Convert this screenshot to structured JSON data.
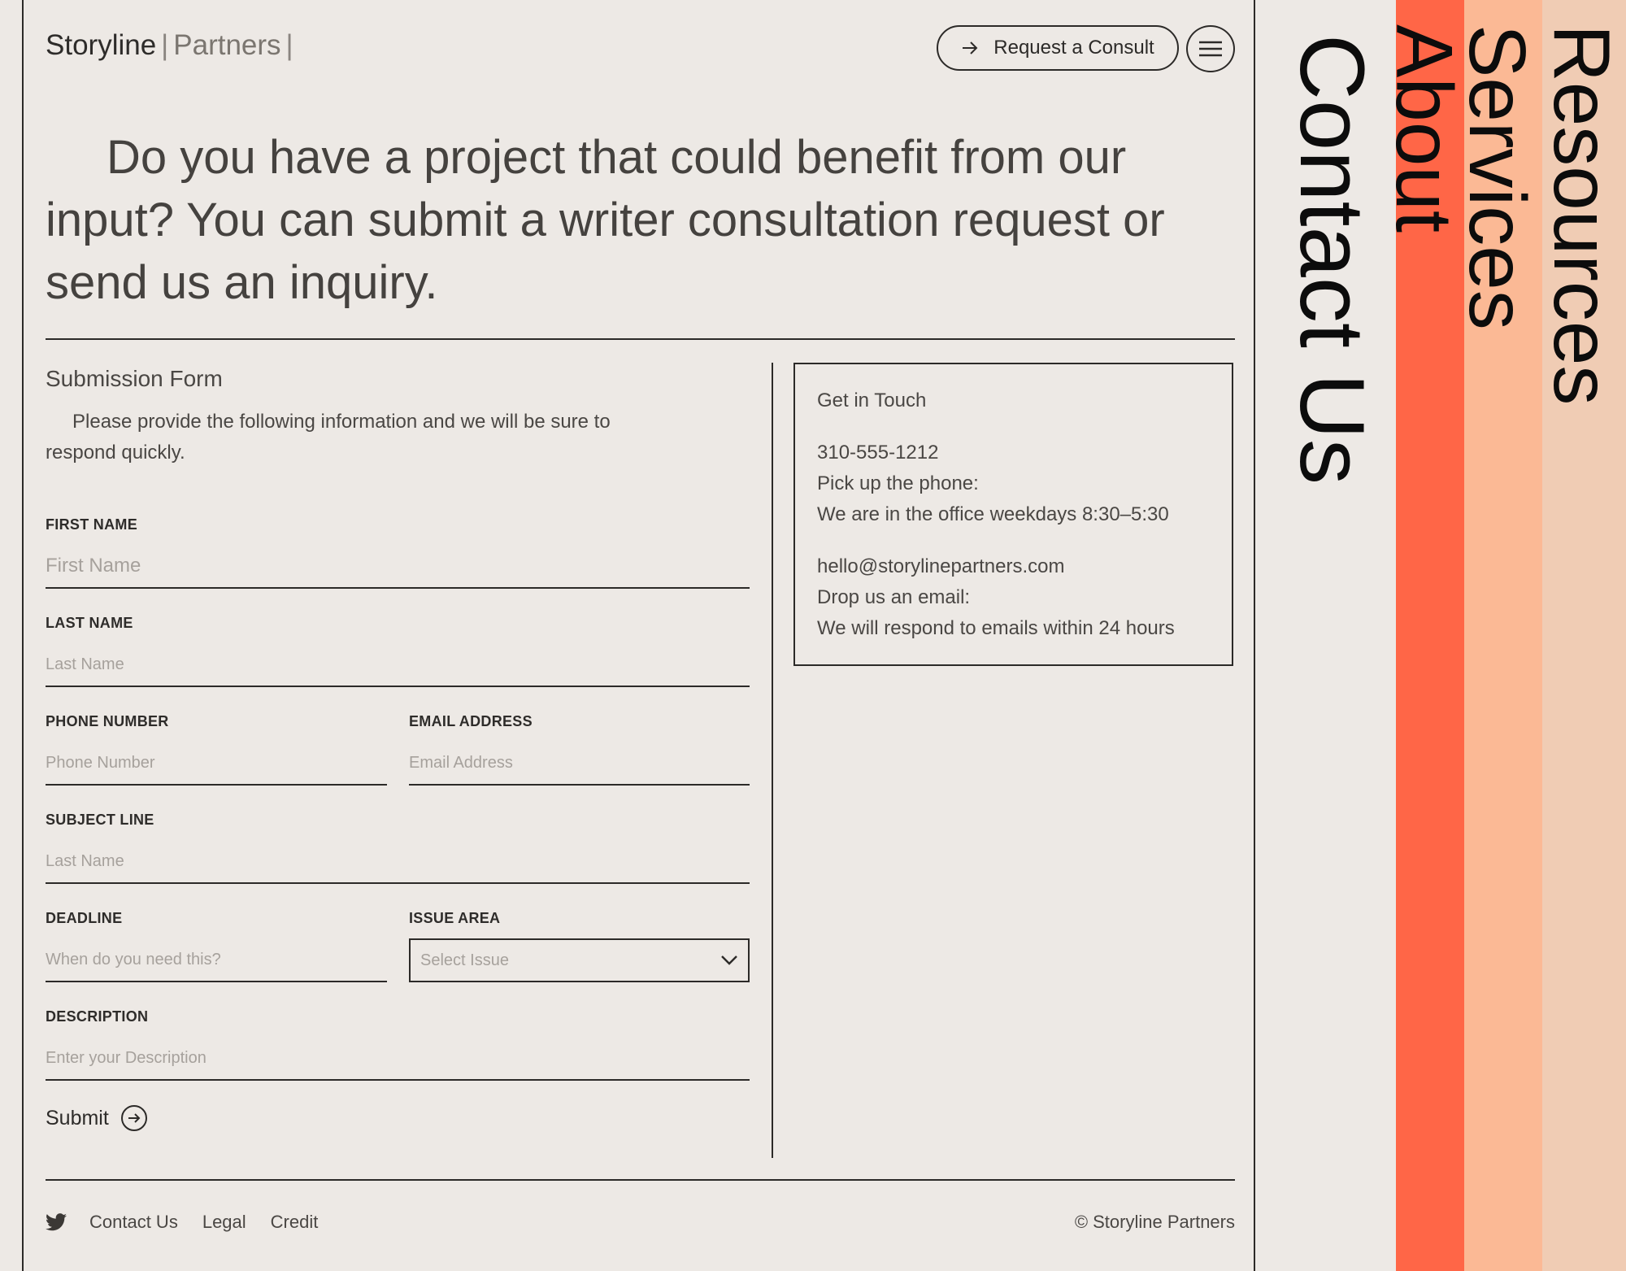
{
  "header": {
    "logo_main": "Storyline",
    "logo_sep_1": "|",
    "logo_sub": "Partners",
    "logo_sep_2": "|",
    "consult_label": "Request a Consult"
  },
  "hero": {
    "text": "Do you have a project that could benefit from  our input? You can submit a writer consultation request or send us an inquiry."
  },
  "form": {
    "title": "Submission Form",
    "intro": "Please provide the following information and we will be sure to respond quickly.",
    "fields": {
      "first_name": {
        "label": "FIRST NAME",
        "placeholder": "First Name"
      },
      "last_name": {
        "label": "LAST NAME",
        "placeholder": "Last Name"
      },
      "phone": {
        "label": "PHONE NUMBER",
        "placeholder": "Phone Number"
      },
      "email": {
        "label": "EMAIL ADDRESS",
        "placeholder": "Email Address"
      },
      "subject": {
        "label": "SUBJECT LINE",
        "placeholder": "Last Name"
      },
      "deadline": {
        "label": "DEADLINE",
        "placeholder": "When do you need this?"
      },
      "issue_area": {
        "label": "ISSUE AREA",
        "selected": "Select Issue"
      },
      "description": {
        "label": "DESCRIPTION",
        "placeholder": "Enter your Description"
      }
    },
    "submit_label": "Submit"
  },
  "contact": {
    "title": "Get in Touch",
    "phone": "310-555-1212",
    "phone_line1": "Pick up the phone:",
    "phone_line2": "We are in the office weekdays 8:30–5:30",
    "email": "hello@storylinepartners.com",
    "email_line1": "Drop us an email:",
    "email_line2": "We will respond to emails within 24 hours"
  },
  "footer": {
    "links": [
      "Contact Us",
      "Legal",
      "Credit"
    ],
    "copyright": "© Storyline Partners"
  },
  "side_nav": {
    "items": [
      {
        "label": "Contact Us",
        "color": "#ede9e5"
      },
      {
        "label": "About",
        "color": "#ff6647"
      },
      {
        "label": "Services",
        "color": "#fbb995"
      },
      {
        "label": "Resources",
        "color": "#f0ccb4"
      }
    ]
  },
  "colors": {
    "background": "#ede9e5",
    "text": "#3b3835",
    "accent": "#ff6647"
  }
}
